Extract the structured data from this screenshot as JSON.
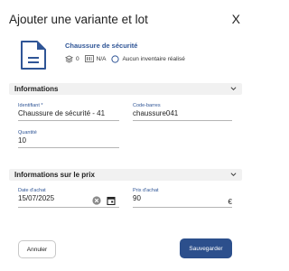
{
  "dialog": {
    "title": "Ajouter une variante et lot",
    "close_label": "X"
  },
  "product": {
    "name": "Chaussure de sécurité",
    "stock_count": "0",
    "barcode_value": "N/A",
    "inventory_status": "Aucun inventaire réalisé",
    "icon": "document-icon"
  },
  "sections": {
    "informations": "Informations",
    "price": "Informations sur le prix"
  },
  "fields": {
    "identifier": {
      "label": "Identifiant *",
      "value": "Chaussure de sécurité - 41"
    },
    "barcode": {
      "label": "Code-barres",
      "value": "chaussure041"
    },
    "quantity": {
      "label": "Quantité",
      "value": "10"
    },
    "purchase_date": {
      "label": "Date d'achat",
      "value": "15/07/2025"
    },
    "purchase_price": {
      "label": "Prix d'achat",
      "value": "90",
      "currency": "€"
    }
  },
  "buttons": {
    "cancel": "Annuler",
    "save": "Sauvegarder"
  },
  "colors": {
    "accent": "#2f5596",
    "primary_button": "#2c4f8c",
    "section_bg": "#f1f1f1"
  }
}
